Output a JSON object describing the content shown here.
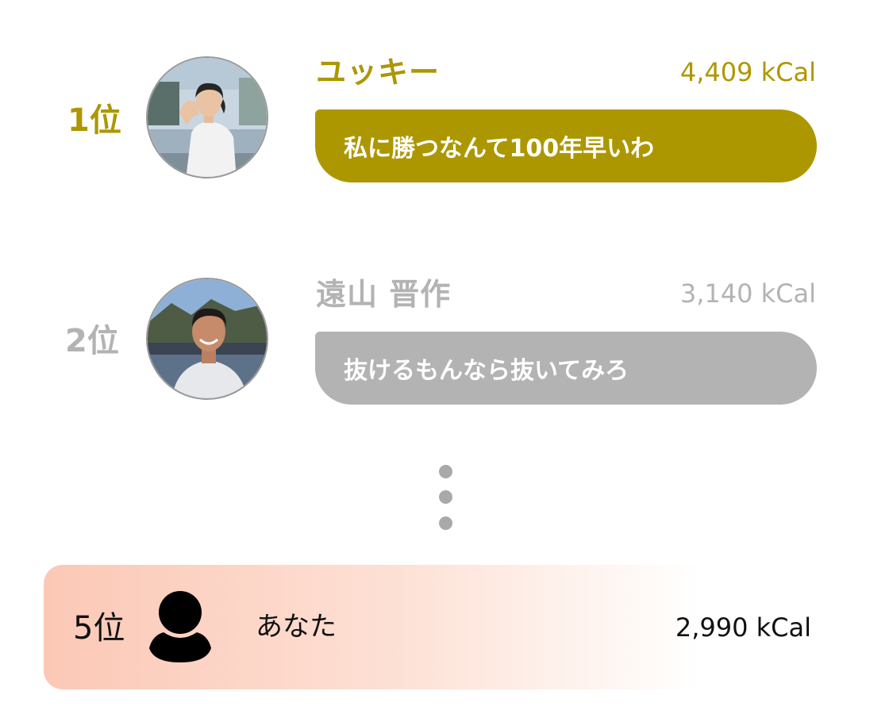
{
  "colors": {
    "gold": "#ad9700",
    "gray": "#b3b3b3",
    "dot": "#a9a9a9",
    "me_gradient_start": "#fcc8b6",
    "text_dark": "#111111"
  },
  "ranking": [
    {
      "rank": "1位",
      "name": "ユッキー",
      "kcal": "4,409 kCal",
      "message": "私に勝つなんて100年早いわ",
      "avatar_icon": "user-photo-woman"
    },
    {
      "rank": "2位",
      "name": "遠山 晋作",
      "kcal": "3,140 kCal",
      "message": "抜けるもんなら抜いてみろ",
      "avatar_icon": "user-photo-man"
    }
  ],
  "me": {
    "rank": "5位",
    "name": "あなた",
    "kcal": "2,990 kCal",
    "icon": "person-icon"
  },
  "separator_icon": "vertical-ellipsis-icon"
}
